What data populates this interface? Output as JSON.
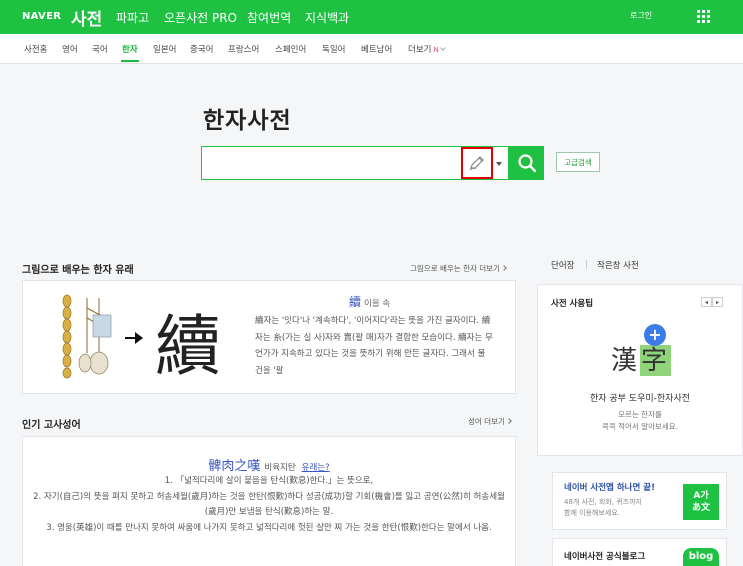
{
  "header": {
    "brand": "NAVER",
    "title": "사전",
    "nav": [
      {
        "label": "파파고"
      },
      {
        "label": "오픈사전 PRO"
      },
      {
        "label": "참여번역"
      },
      {
        "label": "지식백과"
      }
    ],
    "login_label": "로그인",
    "menu_icon": "grid-icon"
  },
  "tabs": [
    {
      "label": "사전홈"
    },
    {
      "label": "영어"
    },
    {
      "label": "국어"
    },
    {
      "label": "한자",
      "active": true
    },
    {
      "label": "일본어"
    },
    {
      "label": "중국어"
    },
    {
      "label": "프랑스어"
    },
    {
      "label": "스페인어"
    },
    {
      "label": "독일어"
    },
    {
      "label": "베트남어"
    },
    {
      "label": "더보기",
      "badge": "N"
    }
  ],
  "search": {
    "page_title": "한자사전",
    "value": "",
    "placeholder": "",
    "handwriting_icon": "pen-icon",
    "search_icon": "search-icon",
    "advanced_label": "고급검색"
  },
  "origin": {
    "heading": "그림으로 배우는 한자 유래",
    "more_label": "그림으로 배우는 한자 더보기",
    "hanja": "續",
    "reading": "이을 속",
    "text": "續자는 '잇다'나 '계속하다', '이어지다'라는 뜻을 가진 글자이다. 續자는 糸(가는 실 사)자와 賣(팔 매)자가 결합한 모습이다. 續자는 무언가가 지속하고 있다는 것을 뜻하기 위해 만든 글자다. 그래서 물건을 '팔"
  },
  "idiom": {
    "heading": "인기 고사성어",
    "more_label": "성어 더보기",
    "hanja": "髀肉之嘆",
    "reading": "비육지탄",
    "related_label": "유래는?",
    "definitions": [
      "1. 「넓적다리에 살이 붙음을 탄식(歎息)한다.」는 뜻으로,",
      "2. 자기(自己)의 뜻을 펴지 못하고 허송세월(歲月)하는 것을 한탄(恨歎)하다 성공(成功)할 기회(機會)를 잃고 공연(公然)히 허송세월(歲月)만 보냄을 탄식(歎息)하는 말.",
      "3. 영웅(英雄)이 때를 만나지 못하여 싸움에 나가지 못하고 넓적다리에 헛된 살만 찌 가는 것을 한탄(恨歎)한다는 말에서 나옴."
    ]
  },
  "sidebar": {
    "tabs": [
      {
        "label": "단어장"
      },
      {
        "label": "작은창 사전"
      }
    ],
    "tool_card": {
      "heading": "사전 사용팁",
      "prev_icon": "chevron-left-icon",
      "next_icon": "chevron-right-icon",
      "illustration": {
        "char1": "漢",
        "char2": "字",
        "badge": "+"
      },
      "title": "한자 공부 도우미-한자사전",
      "desc_lines": [
        "모르는 한자를",
        "콕콕 적어서 알아보세요."
      ]
    },
    "app_card": {
      "title": "네이버 사전앱 하나면 끝!",
      "desc_lines": [
        "48개 사전, 회화, 퀴즈까지",
        "함께 이용해보세요."
      ],
      "icon_lines": [
        "A가",
        "あ文"
      ]
    },
    "blog_card": {
      "title": "네이버사전 공식블로그",
      "icon_label": "blog"
    }
  },
  "colors": {
    "brand_green": "#1fc142",
    "highlight_red": "#e40000",
    "link_blue": "#3b57c6"
  }
}
